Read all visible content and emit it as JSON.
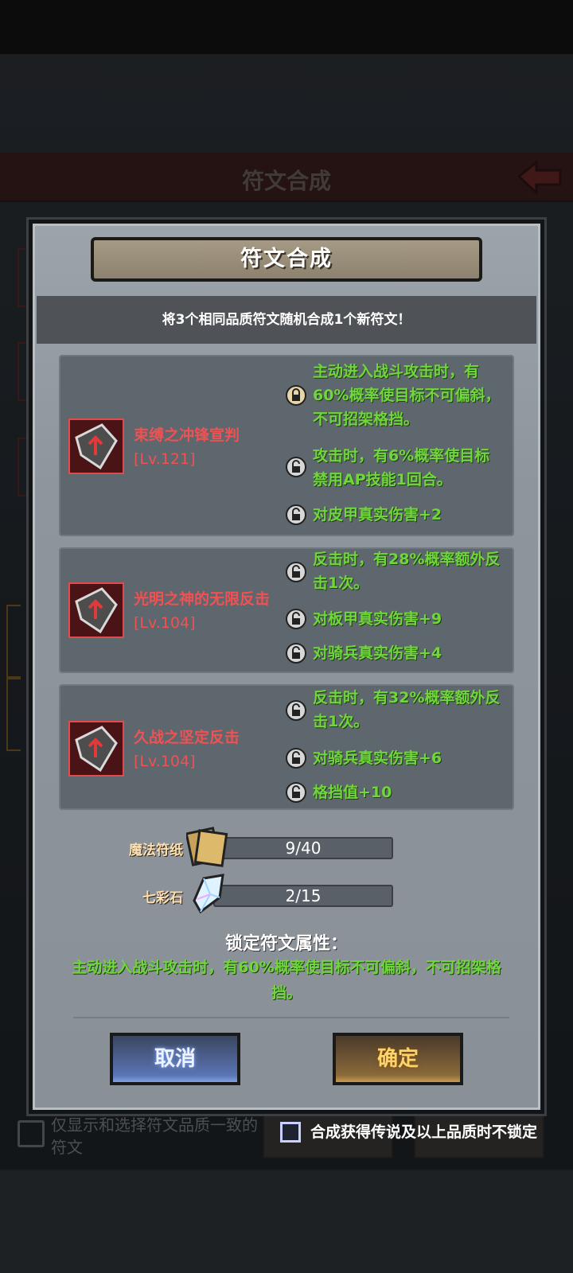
{
  "background": {
    "page_title": "符文合成",
    "filter_label": "仅显示和选择符文品质一致的符文"
  },
  "modal": {
    "title": "符文合成",
    "subtitle": "将3个相同品质符文随机合成1个新符文！",
    "runes": [
      {
        "name": "束缚之冲锋宣判",
        "level": "[Lv.121]",
        "attributes": [
          {
            "text": "主动进入战斗攻击时，有60%概率使目标不可偏斜，不可招架格挡。",
            "locked": true
          },
          {
            "text": "攻击时，有6%概率使目标禁用AP技能1回合。",
            "locked": false
          },
          {
            "text": "对皮甲真实伤害+2",
            "locked": false
          }
        ]
      },
      {
        "name": "光明之神的无限反击",
        "level": "[Lv.104]",
        "attributes": [
          {
            "text": "反击时，有28%概率额外反击1次。",
            "locked": false
          },
          {
            "text": "对板甲真实伤害+9",
            "locked": false
          },
          {
            "text": "对骑兵真实伤害+4",
            "locked": false
          }
        ]
      },
      {
        "name": "久战之坚定反击",
        "level": "[Lv.104]",
        "attributes": [
          {
            "text": "反击时，有32%概率额外反击1次。",
            "locked": false
          },
          {
            "text": "对骑兵真实伤害+6",
            "locked": false
          },
          {
            "text": "格挡值+10",
            "locked": false
          }
        ]
      }
    ],
    "materials": [
      {
        "label": "魔法符纸",
        "amount": "9/40",
        "icon": "magic-paper-icon"
      },
      {
        "label": "七彩石",
        "amount": "2/15",
        "icon": "rainbow-stone-icon"
      }
    ],
    "locked_title": "锁定符文属性：",
    "locked_desc": "主动进入战斗攻击时，有60%概率使目标不可偏斜，不可招架格挡。",
    "cancel_label": "取消",
    "confirm_label": "确定"
  },
  "keep_option": {
    "label": "合成获得传说及以上品质时不锁定",
    "checked": false
  },
  "colors": {
    "attribute_green": "#6fd63c",
    "rune_name_red": "#ee5252",
    "modal_bg": "#9ca4ab"
  }
}
